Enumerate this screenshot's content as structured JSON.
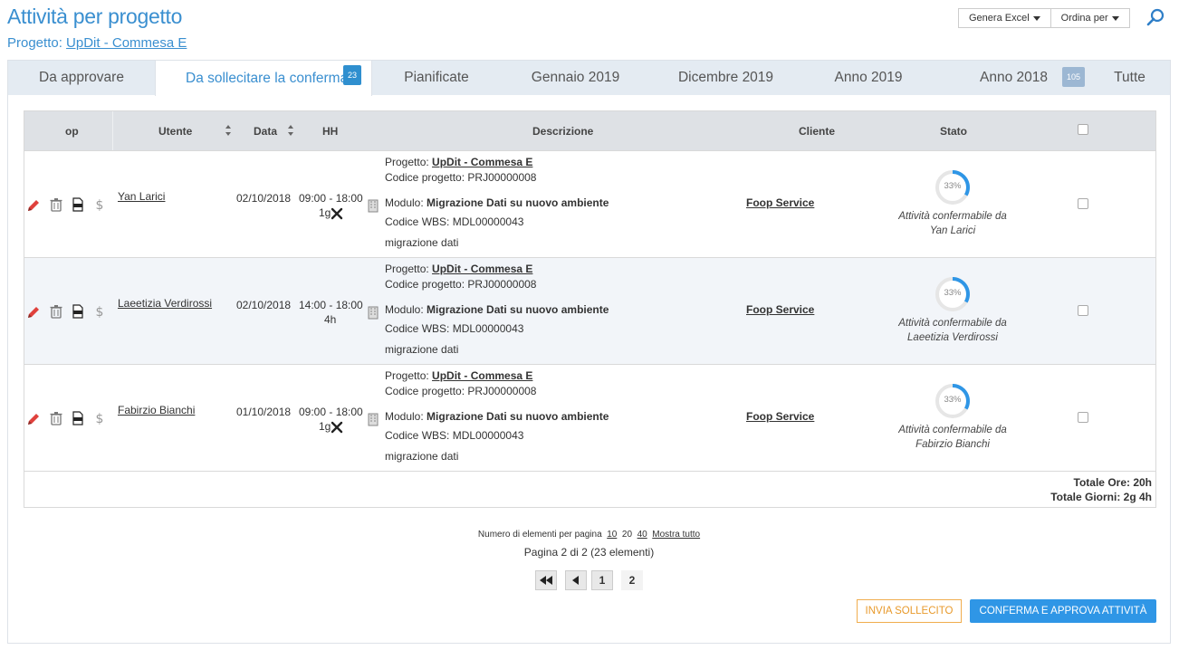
{
  "header": {
    "title": "Attività per progetto",
    "subtitle_label": "Progetto:",
    "subtitle_link": "UpDit - Commesa E",
    "excel_label": "Genera Excel",
    "order_label": "Ordina per"
  },
  "tabs": [
    {
      "label": "Da approvare"
    },
    {
      "label": "Da sollecitare la conferma",
      "badge": "23"
    },
    {
      "label": "Pianificate"
    },
    {
      "label": "Gennaio 2019"
    },
    {
      "label": "Dicembre 2019"
    },
    {
      "label": "Anno 2019"
    },
    {
      "label": "Anno 2018",
      "badge": "105"
    },
    {
      "label": "Tutte"
    }
  ],
  "columns": {
    "op": "op",
    "utente": "Utente",
    "data": "Data",
    "hh": "HH",
    "descrizione": "Descrizione",
    "cliente": "Cliente",
    "stato": "Stato"
  },
  "labels": {
    "progetto": "Progetto:",
    "codice_progetto": "Codice progetto:",
    "modulo": "Modulo:",
    "codice_wbs": "Codice WBS:",
    "stato_prefix": "Attività confermabile da"
  },
  "rows": [
    {
      "utente": "Yan Larici",
      "data": "02/10/2018",
      "hh_range": "09:00 - 18:00",
      "hh_total": "1g",
      "progetto": "UpDit - Commesa E",
      "codice_progetto": "PRJ00000008",
      "modulo": "Migrazione Dati su nuovo ambiente",
      "codice_wbs": "MDL00000043",
      "note": "migrazione dati",
      "cliente": "Foop Service",
      "progress": "33%",
      "confermabile_da": "Yan Larici"
    },
    {
      "utente": "Laeetizia Verdirossi",
      "data": "02/10/2018",
      "hh_range": "14:00 - 18:00",
      "hh_total": "4h",
      "progetto": "UpDit - Commesa E",
      "codice_progetto": "PRJ00000008",
      "modulo": "Migrazione Dati su nuovo ambiente",
      "codice_wbs": "MDL00000043",
      "note": "migrazione dati",
      "cliente": "Foop Service",
      "progress": "33%",
      "confermabile_da": "Laeetizia Verdirossi"
    },
    {
      "utente": "Fabirzio Bianchi",
      "data": "01/10/2018",
      "hh_range": "09:00 - 18:00",
      "hh_total": "1g",
      "progetto": "UpDit - Commesa E",
      "codice_progetto": "PRJ00000008",
      "modulo": "Migrazione Dati su nuovo ambiente",
      "codice_wbs": "MDL00000043",
      "note": "migrazione dati",
      "cliente": "Foop Service",
      "progress": "33%",
      "confermabile_da": "Fabirzio Bianchi"
    }
  ],
  "totals": {
    "ore": "Totale Ore: 20h",
    "giorni": "Totale Giorni: 2g 4h"
  },
  "pagination": {
    "per_page_label": "Numero di elementi per pagina",
    "opt10": "10",
    "opt20": "20",
    "opt40": "40",
    "show_all": "Mostra tutto",
    "info": "Pagina 2 di 2 (23 elementi)",
    "page1": "1",
    "page2": "2"
  },
  "actions": {
    "sollecito": "INVIA SOLLECITO",
    "conferma": "CONFERMA E APPROVA ATTIVITÀ"
  },
  "colors": {
    "accent": "#3a8fd0",
    "badge": "#2f8fcf",
    "badge_light": "#9cb7d3",
    "pencil": "#e0413c",
    "warning": "#f0ad4e",
    "primary": "#2f96e6"
  },
  "icons": [
    "pencil-icon",
    "trash-icon",
    "pdf-icon",
    "dollar-icon",
    "building-icon",
    "tools-icon",
    "search-icon"
  ]
}
